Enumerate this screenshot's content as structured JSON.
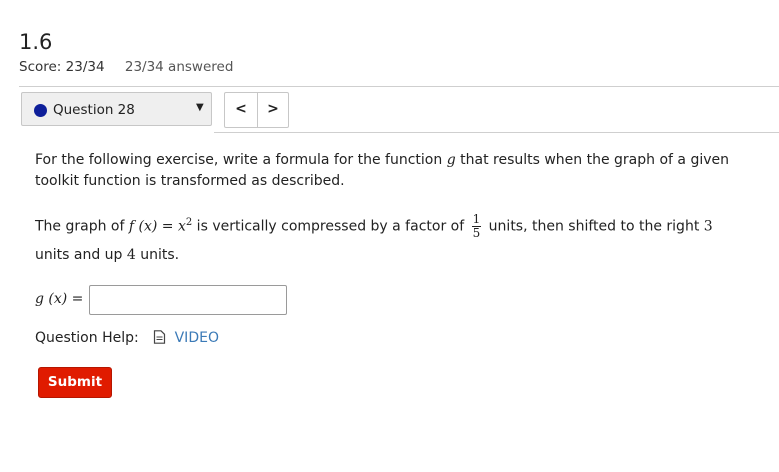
{
  "header": {
    "title": "1.6",
    "score": "Score: 23/34",
    "answered": "23/34 answered"
  },
  "question_nav": {
    "selected": "Question 28",
    "status_color": "#0e1f9a",
    "prev_icon": "chevron-left-icon",
    "next_icon": "chevron-right-icon",
    "prev_symbol": "<",
    "next_symbol": ">",
    "caret_symbol": "▼"
  },
  "question": {
    "intro_a": "For the following exercise, write a formula for the function ",
    "intro_var": "g",
    "intro_b": " that results when the graph of a given toolkit function is transformed as described.",
    "body_a": "The graph of ",
    "body_f": "f (x) = x",
    "body_exp": "2",
    "body_b": " is vertically compressed by a factor of ",
    "frac_num": "1",
    "frac_den": "5",
    "body_c": " units, then shifted to the right ",
    "shift_right": "3",
    "body_d": "units and up ",
    "shift_up": "4",
    "body_e": " units."
  },
  "answer": {
    "label": "g (x) =",
    "value": ""
  },
  "help": {
    "label": "Question Help:",
    "video_label": "VIDEO",
    "icon": "document-icon"
  },
  "submit_label": "Submit",
  "colors": {
    "submit": "#e01b00",
    "link": "#3b7ab7"
  }
}
